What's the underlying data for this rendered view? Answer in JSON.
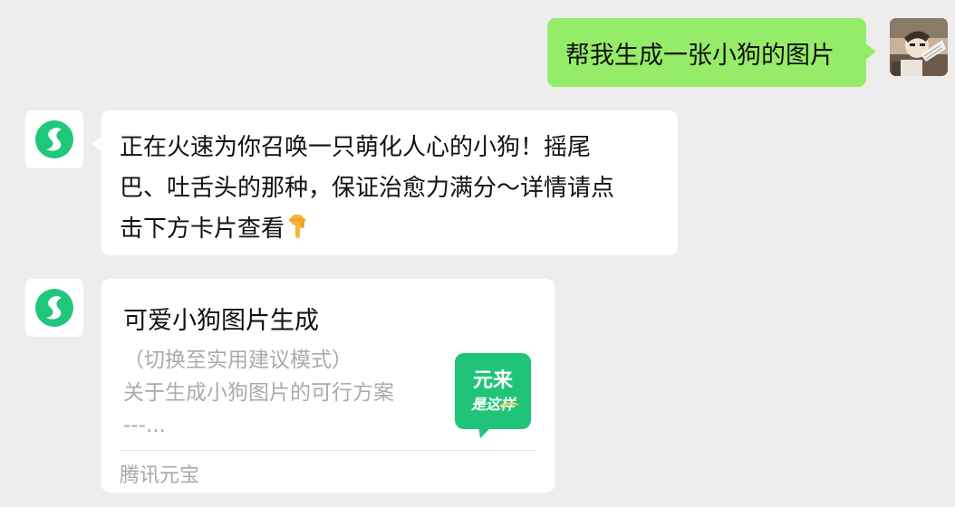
{
  "user_message": {
    "text": "帮我生成一张小狗的图片"
  },
  "bot_message": {
    "lines": [
      "正在火速为你召唤一只萌化人心的小狗！摇尾",
      "巴、吐舌头的那种，保证治愈力满分～详情请点",
      "击下方卡片查看"
    ],
    "trailing_icon": "backhand-index-pointing-down-icon"
  },
  "card": {
    "title": "可爱小狗图片生成",
    "desc_lines": [
      "（切换至实用建议模式）",
      "关于生成小狗图片的可行方案",
      "---..."
    ],
    "thumbnail": {
      "line1": "元来",
      "line2": "是这样"
    },
    "source": "腾讯元宝"
  },
  "colors": {
    "background": "#ededed",
    "user_bubble": "#95ec69",
    "bot_bubble": "#ffffff",
    "brand_green": "#1ec77a"
  }
}
